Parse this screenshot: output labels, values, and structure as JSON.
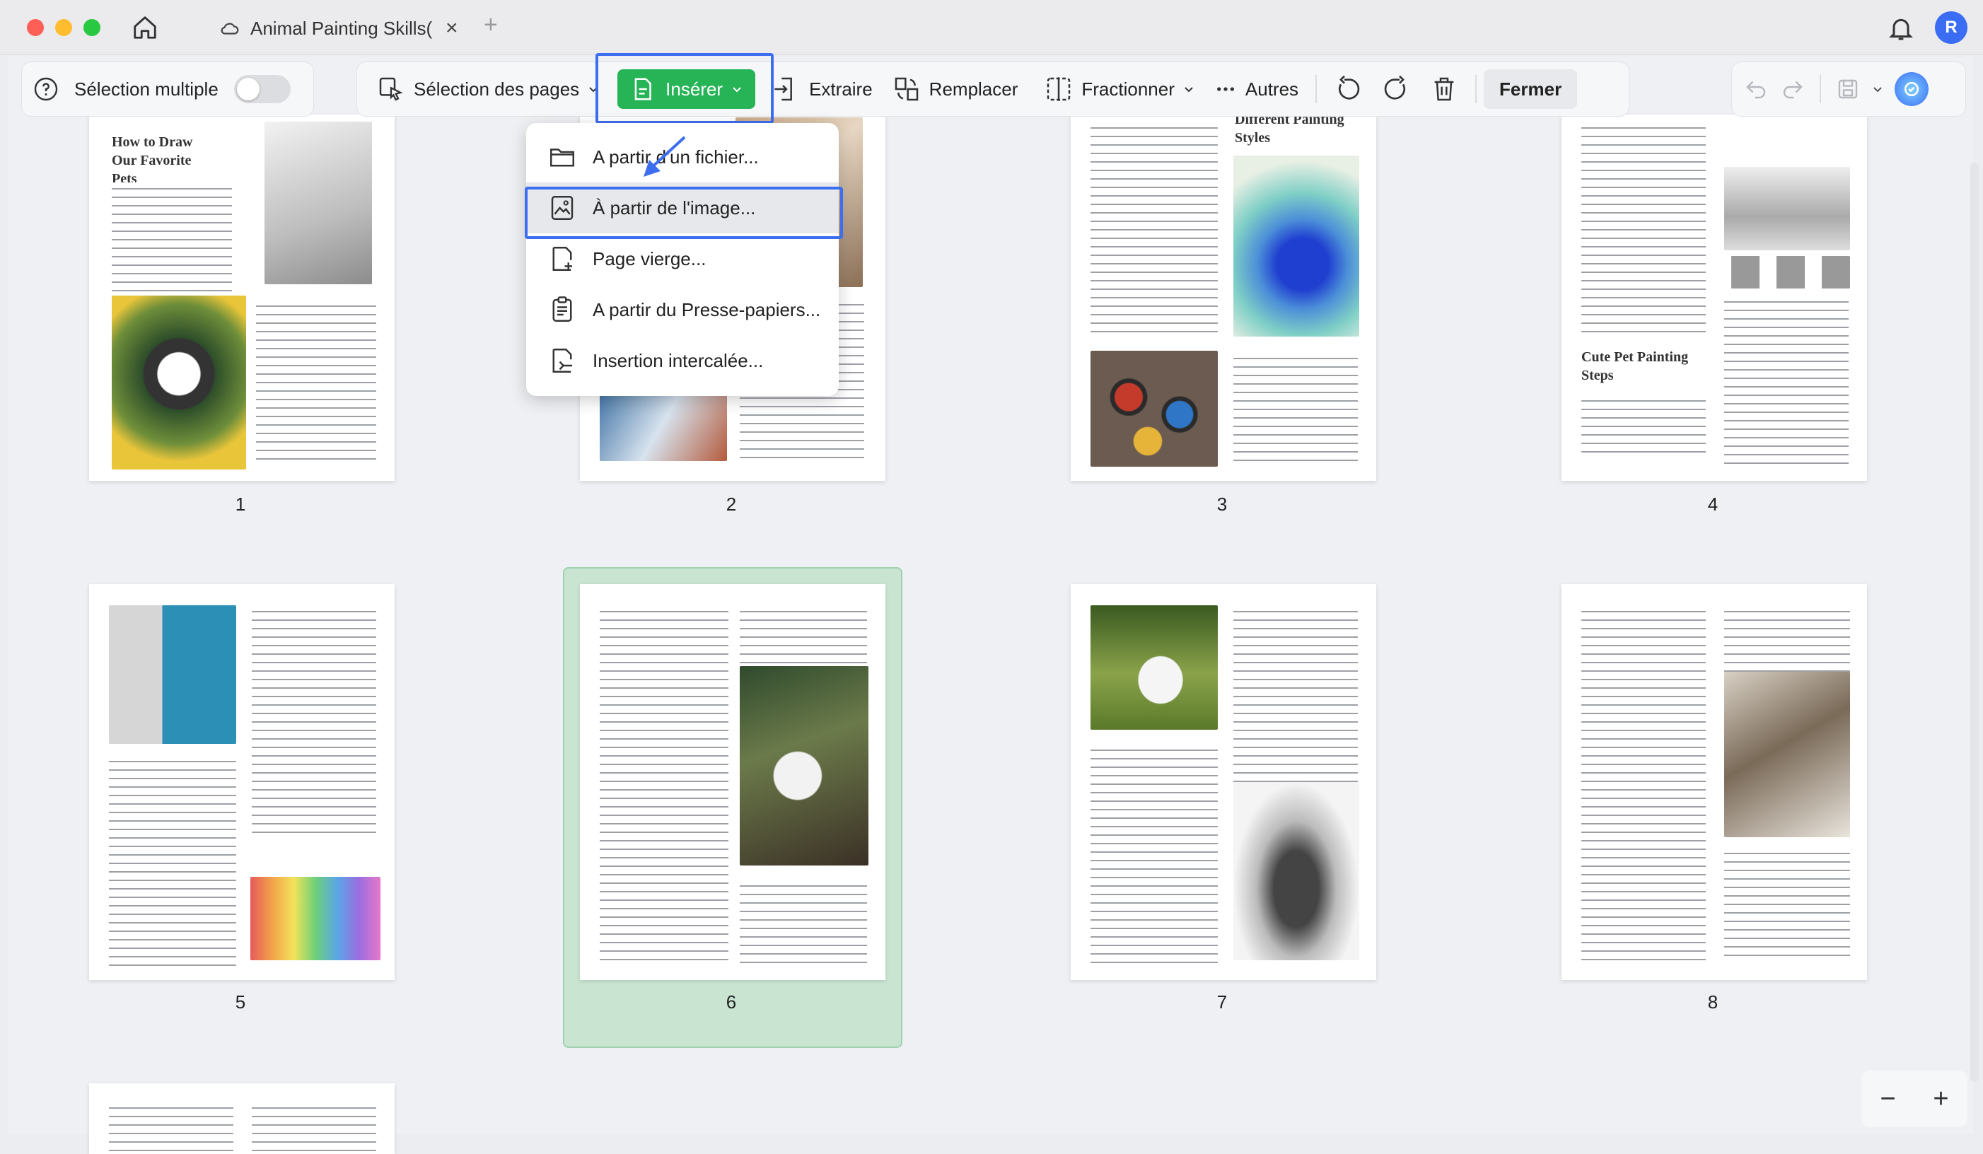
{
  "window": {
    "tab_title": "Animal Painting Skills(",
    "avatar_initial": "R"
  },
  "toolbar": {
    "multi_select": "Sélection multiple",
    "select_pages": "Sélection des pages",
    "insert": "Insérer",
    "extract": "Extraire",
    "replace": "Remplacer",
    "split": "Fractionner",
    "more": "Autres",
    "close": "Fermer"
  },
  "insert_menu": {
    "items": [
      {
        "label": "A partir d'un fichier...",
        "icon": "folder-icon"
      },
      {
        "label": "À partir de l'image...",
        "icon": "image-icon"
      },
      {
        "label": "Page vierge...",
        "icon": "blank-page-icon"
      },
      {
        "label": "A partir du Presse-papiers...",
        "icon": "clipboard-icon"
      },
      {
        "label": "Insertion intercalée...",
        "icon": "interleave-icon"
      }
    ]
  },
  "pages": [
    {
      "number": "1",
      "heading": "How to Draw Our Favorite Pets"
    },
    {
      "number": "2",
      "heading": ""
    },
    {
      "number": "3",
      "heading": "Different Painting Styles"
    },
    {
      "number": "4",
      "heading": "Cute Pet Painting Steps"
    },
    {
      "number": "5",
      "heading": ""
    },
    {
      "number": "6",
      "heading": ""
    },
    {
      "number": "7",
      "heading": ""
    },
    {
      "number": "8",
      "heading": ""
    }
  ],
  "zoom": {
    "out": "−",
    "in": "+"
  },
  "colors": {
    "accent_green": "#26b457",
    "highlight_blue": "#3e6ef0",
    "selected_page_bg": "#c9e5d2"
  }
}
